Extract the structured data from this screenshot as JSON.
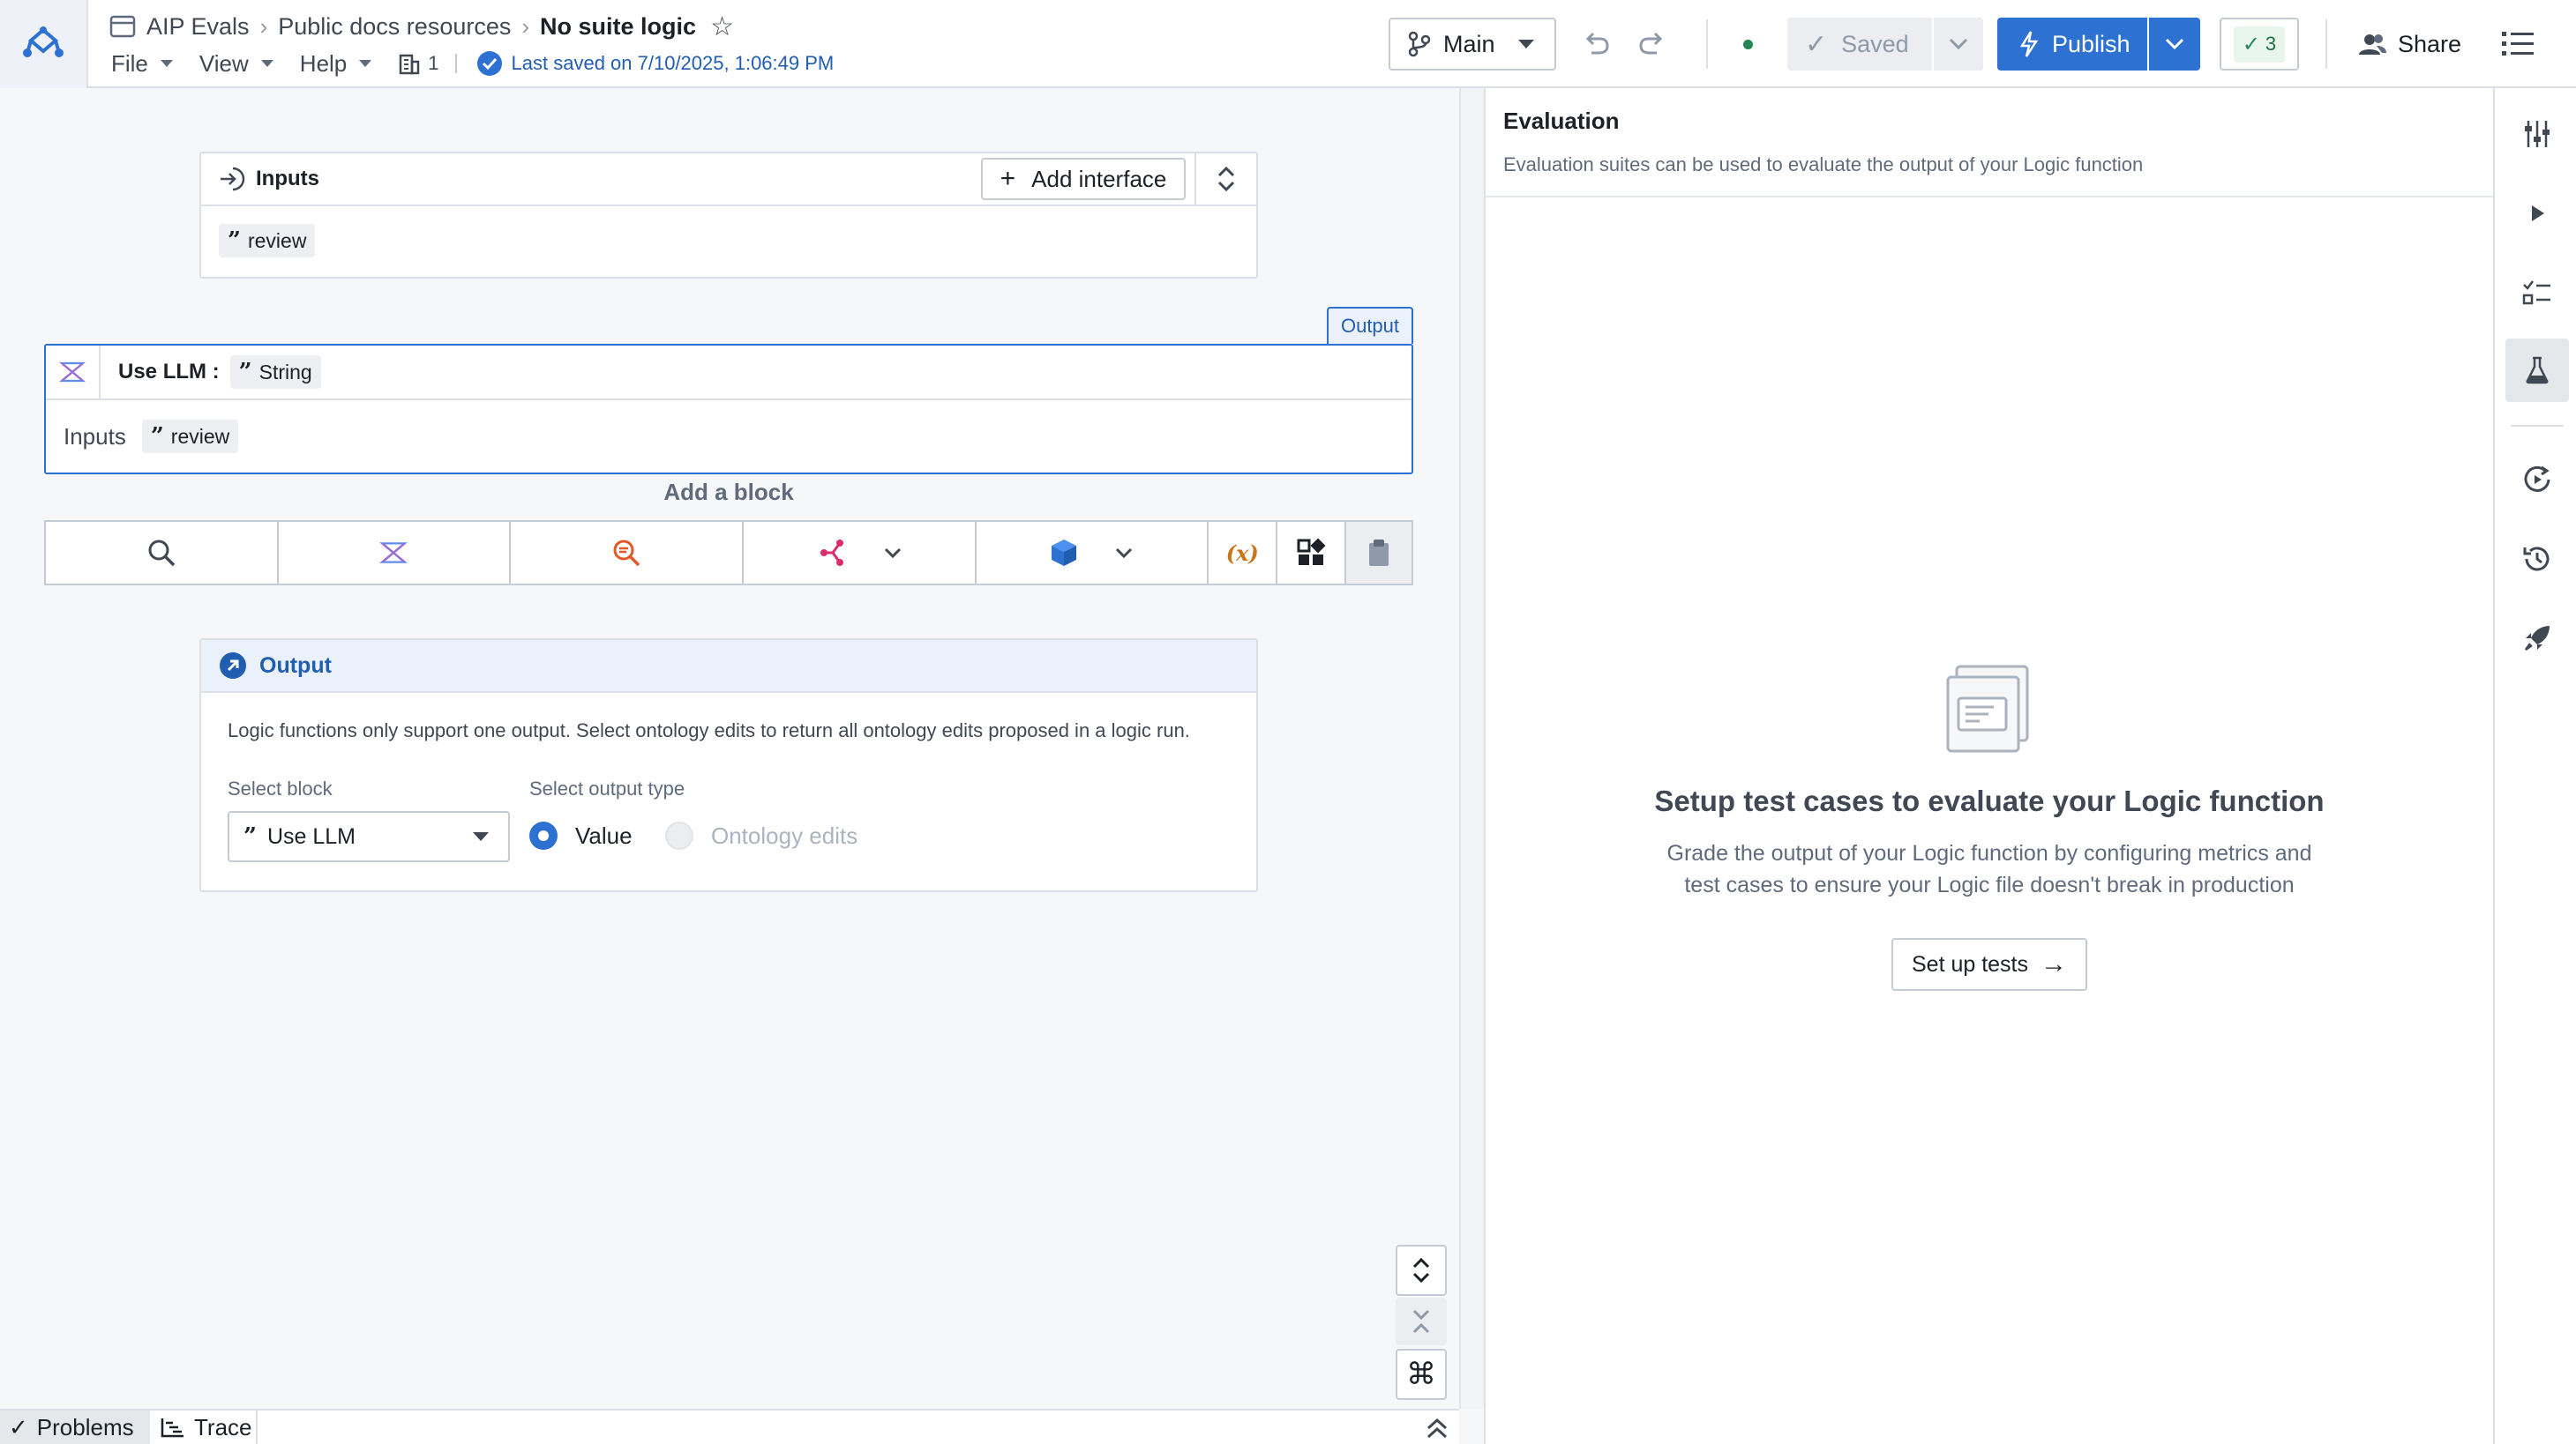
{
  "header": {
    "breadcrumb": [
      "AIP Evals",
      "Public docs resources"
    ],
    "current": "No suite logic",
    "menu": [
      "File",
      "View",
      "Help"
    ],
    "resource_count": "1",
    "last_saved": "Last saved on 7/10/2025, 1:06:49 PM",
    "branch": "Main",
    "saved_label": "Saved",
    "publish_label": "Publish",
    "checks_count": "3",
    "share_label": "Share"
  },
  "inputs_card": {
    "title": "Inputs",
    "add_interface_label": "Add interface",
    "param": "review"
  },
  "llm_block": {
    "output_tag": "Output",
    "title": "Use LLM :",
    "type": "String",
    "inputs_label": "Inputs",
    "input_param": "review"
  },
  "add_block": {
    "label": "Add a block",
    "variable_label": "(x)"
  },
  "output_card": {
    "title": "Output",
    "description": "Logic functions only support one output. Select ontology edits to return all ontology edits proposed in a logic run.",
    "select_block_label": "Select block",
    "select_block_value": "Use LLM",
    "output_type_label": "Select output type",
    "options": [
      "Value",
      "Ontology edits"
    ],
    "selected_option": "Value"
  },
  "evaluation": {
    "title": "Evaluation",
    "subtitle": "Evaluation suites can be used to evaluate the output of your Logic function",
    "empty_title": "Setup test cases to evaluate your Logic function",
    "empty_text_line1": "Grade the output of your Logic function by configuring metrics and",
    "empty_text_line2": "test cases to ensure your Logic file doesn't break in production",
    "cta": "Set up tests"
  },
  "bottom_bar": {
    "problems_label": "Problems",
    "trace_label": "Trace"
  },
  "colors": {
    "primary": "#2d72d2",
    "success": "#238551",
    "llm_block_border": "#2d72d2",
    "output_header_bg": "#ebf1fa"
  }
}
